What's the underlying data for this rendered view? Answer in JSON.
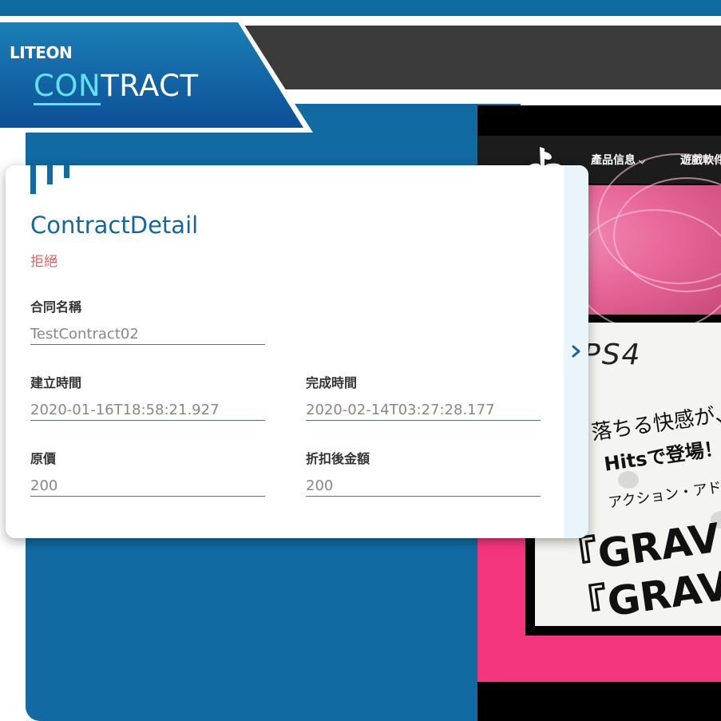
{
  "brand": {
    "logo_text": "LITEON",
    "title_highlight": "CON",
    "title_rest": "TRACT"
  },
  "contract_detail": {
    "title": "ContractDetail",
    "status": "拒絕",
    "fields": {
      "name_label": "合同名稱",
      "name_value": "TestContract02",
      "created_label": "建立時間",
      "created_value": "2020-01-16T18:58:21.927",
      "completed_label": "完成時間",
      "completed_value": "2020-02-14T03:27:28.177",
      "original_price_label": "原價",
      "original_price_value": "200",
      "discounted_amount_label": "折扣後金額",
      "discounted_amount_value": "200"
    }
  },
  "promo": {
    "nav": {
      "item1": "產品信息",
      "item2": "遊戲軟件"
    },
    "ps4_label": "PS4",
    "line1": "落ちる快感が、さ",
    "line2": "Hitsで登場！",
    "line3": "アクション・アドベ",
    "title_a": "『GRAVITY",
    "title_b": "『GRAVITY"
  },
  "colors": {
    "brand_blue": "#116aa2",
    "accent_cyan": "#63e0f0",
    "status_red": "#e0636b",
    "promo_pink": "#f5357e"
  },
  "icons": {
    "expand": "chevron-right-icon",
    "nav_dropdown": "chevron-down-icon",
    "playstation": "playstation-icon"
  }
}
